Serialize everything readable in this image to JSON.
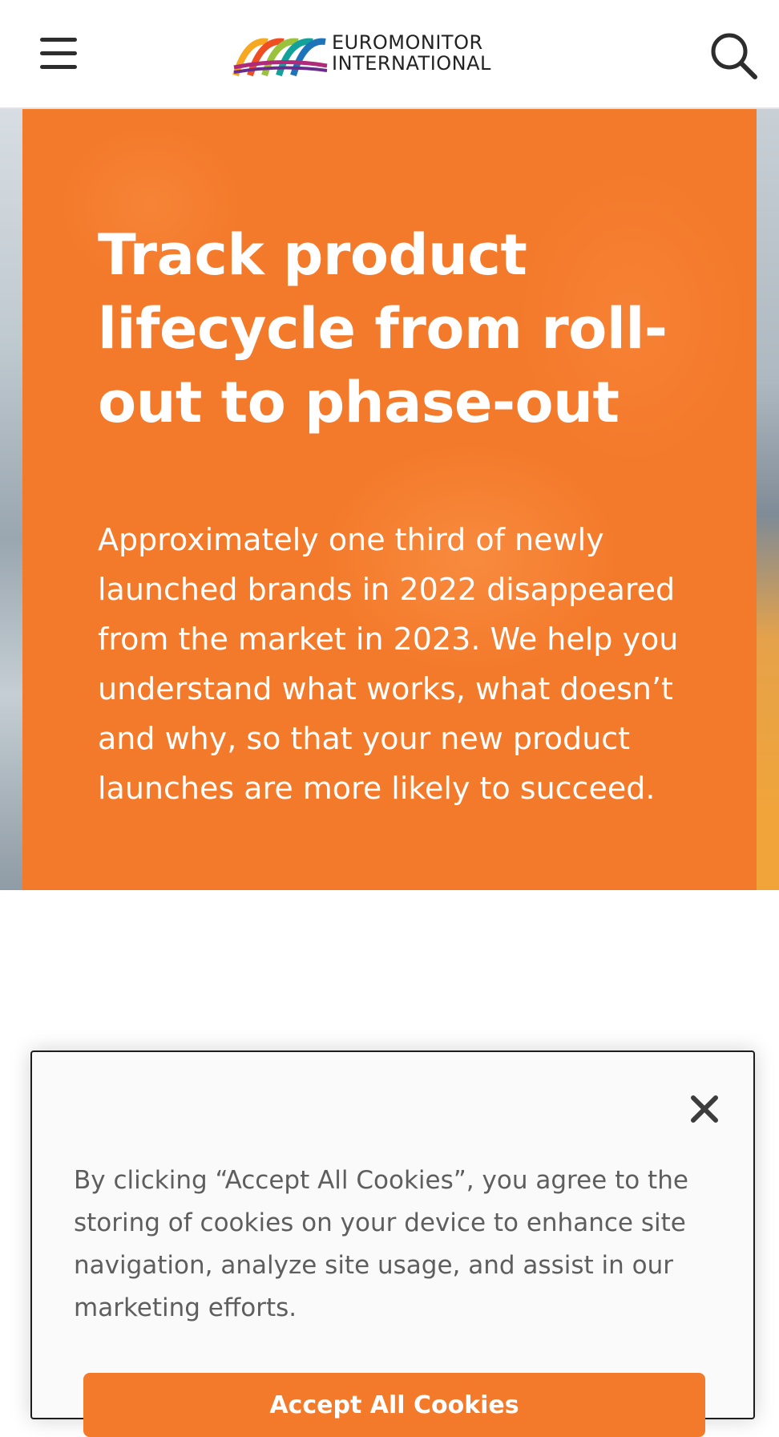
{
  "header": {
    "logo_line1": "EUROMONITOR",
    "logo_line2": "INTERNATIONAL",
    "menu_icon": "hamburger-menu-icon",
    "search_icon": "search-icon"
  },
  "hero": {
    "title": "Track product lifecycle from roll-out to phase-out",
    "body": "Approximately one third of newly launched brands in 2022 disappeared from the market in 2023. We help you understand what works, what doesn’t and why, so that your new product launches are more likely to succeed.",
    "panel_color": "#f47a2b"
  },
  "cookie_banner": {
    "text": "By clicking “Accept All Cookies”, you agree to the storing of cookies on your device to enhance site navigation, analyze site usage, and assist in our marketing efforts.",
    "close_icon": "close-icon",
    "accept_label": "Accept All Cookies",
    "accent_color": "#f47a2b"
  }
}
